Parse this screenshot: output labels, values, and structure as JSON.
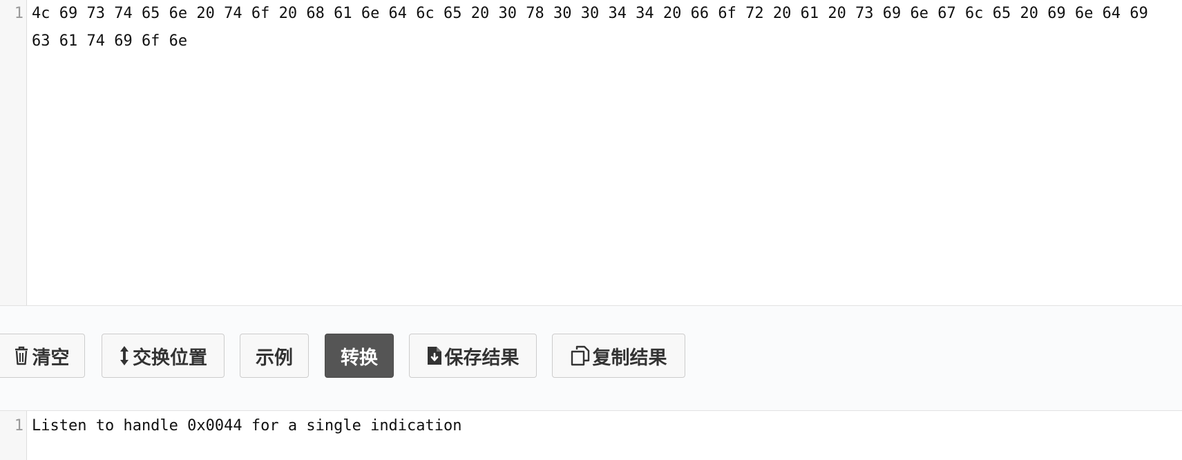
{
  "input_editor": {
    "line_number": "1",
    "content": "4c 69 73 74 65 6e 20 74 6f 20 68 61 6e 64 6c 65 20 30 78 30 30 34 34 20 66 6f 72 20 61 20 73 69 6e 67 6c 65 20 69 6e 64 69 63 61 74 69 6f 6e"
  },
  "toolbar": {
    "clear_label": "清空",
    "swap_label": "交换位置",
    "example_label": "示例",
    "convert_label": "转换",
    "save_label": "保存结果",
    "copy_label": "复制结果"
  },
  "output_editor": {
    "line_number": "1",
    "content": "Listen to handle 0x0044 for a single indication"
  },
  "icons": {
    "clear": "trash-icon",
    "swap": "vertical-arrows-icon",
    "save": "file-download-icon",
    "copy": "copy-icon"
  },
  "colors": {
    "primary_button": "#555555",
    "toolbar_background": "#fafbfc",
    "gutter_background": "#f7f7f7"
  }
}
